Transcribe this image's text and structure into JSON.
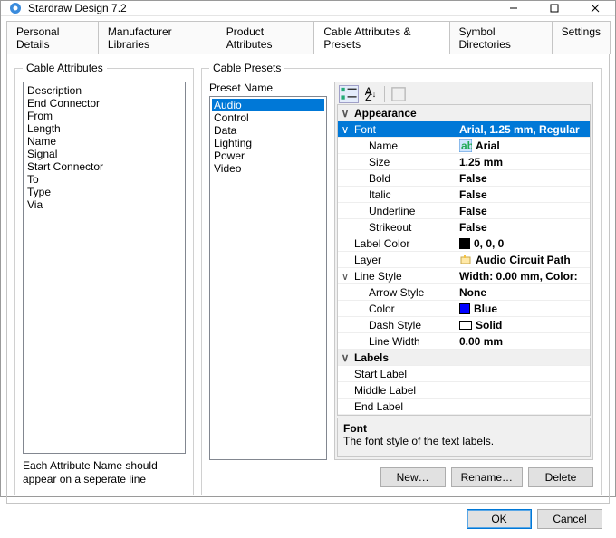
{
  "window": {
    "title": "Stardraw Design 7.2"
  },
  "tabs": {
    "items": [
      {
        "label": "Personal Details",
        "active": false
      },
      {
        "label": "Manufacturer Libraries",
        "active": false
      },
      {
        "label": "Product Attributes",
        "active": false
      },
      {
        "label": "Cable Attributes & Presets",
        "active": true
      },
      {
        "label": "Symbol Directories",
        "active": false
      },
      {
        "label": "Settings",
        "active": false
      }
    ]
  },
  "cable_attributes": {
    "legend": "Cable Attributes",
    "items": [
      "Description",
      "End Connector",
      "From",
      "Length",
      "Name",
      "Signal",
      "Start Connector",
      "To",
      "Type",
      "Via"
    ],
    "hint": "Each Attribute Name should appear on a seperate line"
  },
  "cable_presets": {
    "legend": "Cable Presets",
    "preset_name_label": "Preset Name",
    "list": [
      {
        "label": "Audio",
        "selected": true
      },
      {
        "label": "Control",
        "selected": false
      },
      {
        "label": "Data",
        "selected": false
      },
      {
        "label": "Lighting",
        "selected": false
      },
      {
        "label": "Power",
        "selected": false
      },
      {
        "label": "Video",
        "selected": false
      }
    ],
    "buttons": {
      "new": "New…",
      "rename": "Rename…",
      "delete": "Delete"
    }
  },
  "propgrid": {
    "cat_appearance": "Appearance",
    "font": {
      "name": "Font",
      "value": "Arial, 1.25 mm, Regular"
    },
    "font_name": {
      "name": "Name",
      "value": "Arial"
    },
    "font_size": {
      "name": "Size",
      "value": "1.25 mm"
    },
    "font_bold": {
      "name": "Bold",
      "value": "False"
    },
    "font_italic": {
      "name": "Italic",
      "value": "False"
    },
    "font_underline": {
      "name": "Underline",
      "value": "False"
    },
    "font_strikeout": {
      "name": "Strikeout",
      "value": "False"
    },
    "label_color": {
      "name": "Label Color",
      "value": "0, 0, 0",
      "swatch": "#000000"
    },
    "layer": {
      "name": "Layer",
      "value": "Audio Circuit Path"
    },
    "line_style": {
      "name": "Line Style",
      "value": "Width: 0.00 mm, Color:"
    },
    "arrow_style": {
      "name": "Arrow Style",
      "value": "None"
    },
    "ls_color": {
      "name": "Color",
      "value": "Blue",
      "swatch": "#0000ff"
    },
    "dash_style": {
      "name": "Dash Style",
      "value": "Solid"
    },
    "line_width": {
      "name": "Line Width",
      "value": "0.00 mm"
    },
    "cat_labels": "Labels",
    "start_label": {
      "name": "Start Label",
      "value": ""
    },
    "middle_label": {
      "name": "Middle Label",
      "value": ""
    },
    "end_label": {
      "name": "End Label",
      "value": ""
    },
    "desc": {
      "title": "Font",
      "text": "The font style of the text labels."
    }
  },
  "dialog_buttons": {
    "ok": "OK",
    "cancel": "Cancel"
  }
}
